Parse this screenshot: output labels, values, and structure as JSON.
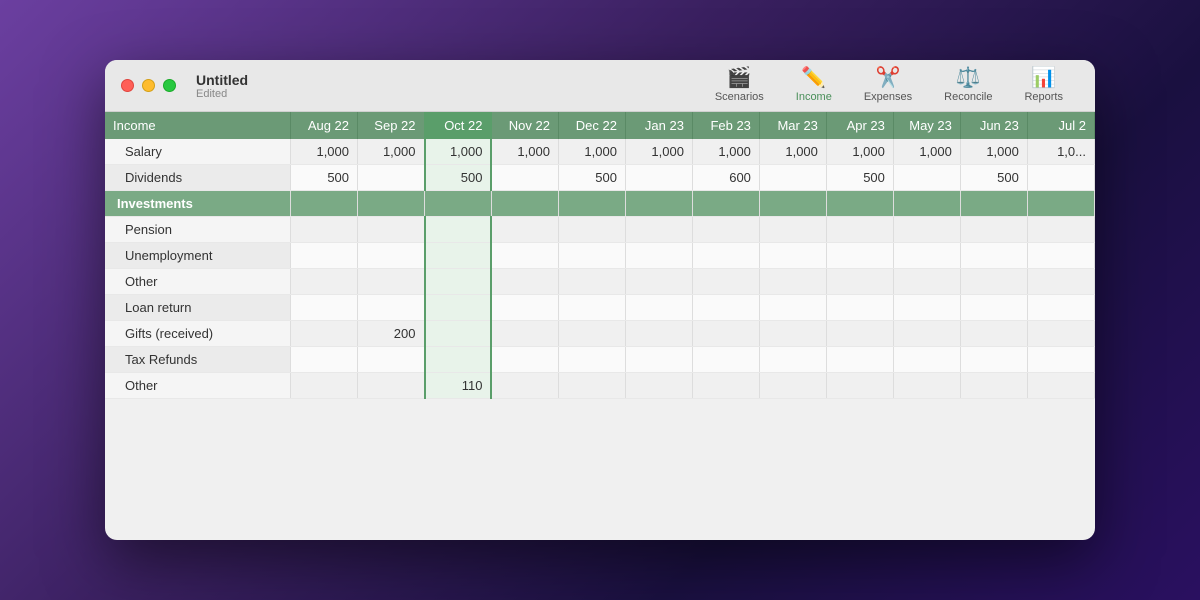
{
  "window": {
    "title": "Untitled",
    "subtitle": "Edited"
  },
  "toolbar": {
    "items": [
      {
        "id": "scenarios",
        "label": "Scenarios",
        "icon": "🎬"
      },
      {
        "id": "income",
        "label": "Income",
        "icon": "✏️",
        "active": true
      },
      {
        "id": "expenses",
        "label": "Expenses",
        "icon": "✂️"
      },
      {
        "id": "reconcile",
        "label": "Reconcile",
        "icon": "⚖️"
      },
      {
        "id": "reports",
        "label": "Reports",
        "icon": "📊"
      }
    ]
  },
  "columns": [
    {
      "id": "category",
      "label": "Income"
    },
    {
      "id": "aug22",
      "label": "Aug 22"
    },
    {
      "id": "sep22",
      "label": "Sep 22"
    },
    {
      "id": "oct22",
      "label": "Oct 22"
    },
    {
      "id": "nov22",
      "label": "Nov 22"
    },
    {
      "id": "dec22",
      "label": "Dec 22"
    },
    {
      "id": "jan23",
      "label": "Jan 23"
    },
    {
      "id": "feb23",
      "label": "Feb 23"
    },
    {
      "id": "mar23",
      "label": "Mar 23"
    },
    {
      "id": "apr23",
      "label": "Apr 23"
    },
    {
      "id": "may23",
      "label": "May 23"
    },
    {
      "id": "jun23",
      "label": "Jun 23"
    },
    {
      "id": "jul23",
      "label": "Jul 2"
    }
  ],
  "rows": [
    {
      "type": "data",
      "alt": false,
      "cells": [
        "Salary",
        "1,000",
        "1,000",
        "1,000",
        "1,000",
        "1,000",
        "1,000",
        "1,000",
        "1,000",
        "1,000",
        "1,000",
        "1,000",
        "1,0..."
      ]
    },
    {
      "type": "data",
      "alt": true,
      "cells": [
        "Dividends",
        "500",
        "",
        "500",
        "",
        "500",
        "",
        "600",
        "",
        "500",
        "",
        "500",
        ""
      ]
    },
    {
      "type": "category",
      "cells": [
        "Investments",
        "",
        "",
        "",
        "",
        "",
        "",
        "",
        "",
        "",
        "",
        "",
        ""
      ]
    },
    {
      "type": "data",
      "alt": false,
      "cells": [
        "Pension",
        "",
        "",
        "",
        "",
        "",
        "",
        "",
        "",
        "",
        "",
        "",
        ""
      ]
    },
    {
      "type": "data",
      "alt": true,
      "cells": [
        "Unemployment",
        "",
        "",
        "",
        "",
        "",
        "",
        "",
        "",
        "",
        "",
        "",
        ""
      ]
    },
    {
      "type": "data",
      "alt": false,
      "cells": [
        "Other",
        "",
        "",
        "",
        "",
        "",
        "",
        "",
        "",
        "",
        "",
        "",
        ""
      ]
    },
    {
      "type": "data",
      "alt": true,
      "cells": [
        "Loan return",
        "",
        "",
        "",
        "",
        "",
        "",
        "",
        "",
        "",
        "",
        "",
        ""
      ]
    },
    {
      "type": "data",
      "alt": false,
      "cells": [
        "Gifts (received)",
        "",
        "200",
        "",
        "",
        "",
        "",
        "",
        "",
        "",
        "",
        "",
        ""
      ]
    },
    {
      "type": "data",
      "alt": true,
      "cells": [
        "Tax Refunds",
        "",
        "",
        "",
        "",
        "",
        "",
        "",
        "",
        "",
        "",
        "",
        ""
      ]
    },
    {
      "type": "data",
      "alt": false,
      "cells": [
        "Other",
        "",
        "",
        "110",
        "",
        "",
        "",
        "",
        "",
        "",
        "",
        "",
        ""
      ]
    }
  ]
}
